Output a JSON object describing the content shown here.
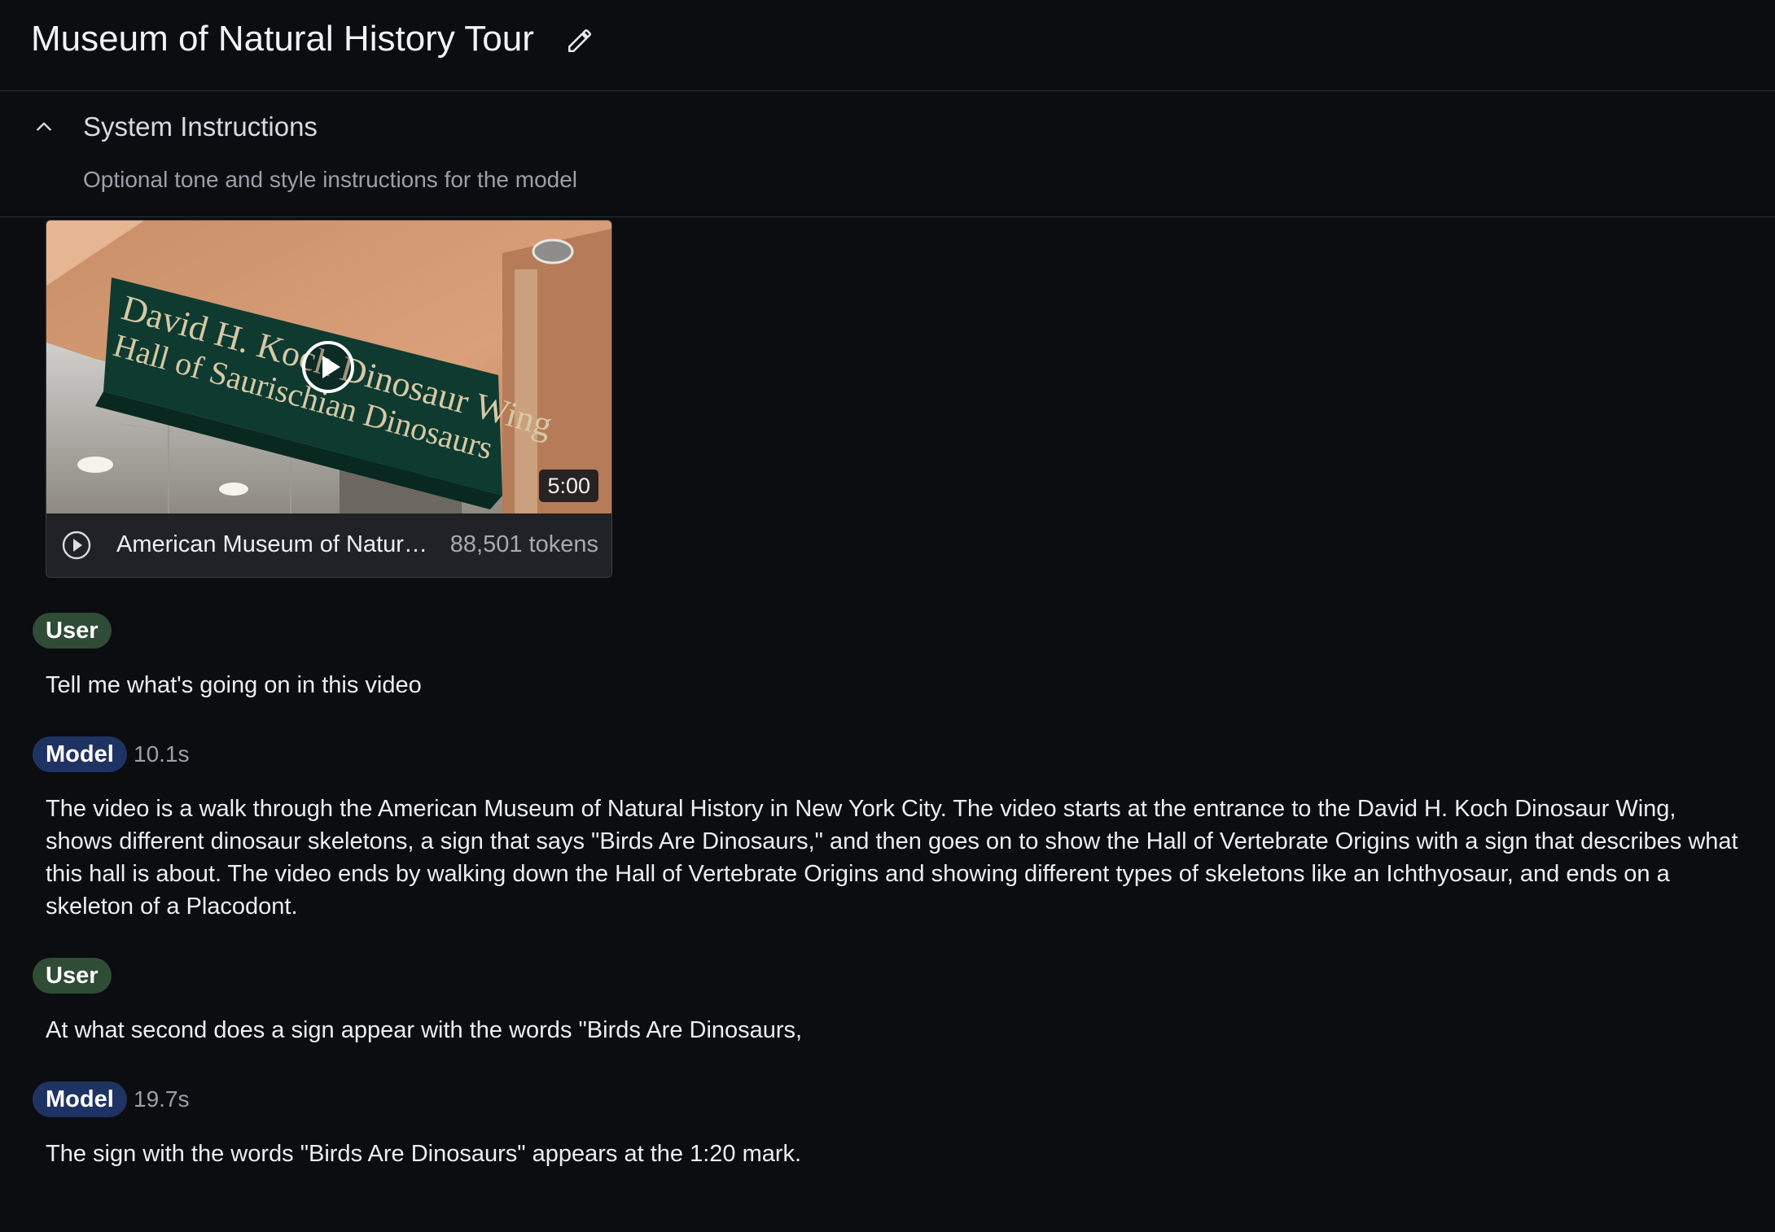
{
  "header": {
    "title": "Museum of Natural History Tour",
    "edit_icon": "pencil-icon"
  },
  "system_instructions": {
    "label": "System Instructions",
    "placeholder": "Optional tone and style instructions for the model",
    "toggle_icon": "chevron-up-icon"
  },
  "video": {
    "name": "American Museum of Natural ...",
    "tokens": "88,501 tokens",
    "duration": "5:00",
    "sign_line1": "David H. Koch Dinosaur Wing",
    "sign_line2": "Hall of Saurischian Dinosaurs",
    "play_icon": "play-circle-icon"
  },
  "messages": [
    {
      "role": "User",
      "text": "Tell me what's going on in this video"
    },
    {
      "role": "Model",
      "elapsed": "10.1s",
      "text": "The video is a walk through the American Museum of Natural History in New York City. The video starts at the entrance to the David H. Koch Dinosaur Wing, shows different dinosaur skeletons, a sign that says \"Birds Are Dinosaurs,\" and then goes on to show the Hall of Vertebrate Origins with a sign that describes what this hall is about. The video ends by walking down the Hall of Vertebrate Origins and showing different types of skeletons like an Ichthyosaur, and ends on a skeleton of a Placodont."
    },
    {
      "role": "User",
      "text": "At what second does a sign appear with the words \"Birds Are Dinosaurs,"
    },
    {
      "role": "Model",
      "elapsed": "19.7s",
      "text": "The sign with the words \"Birds Are Dinosaurs\" appears at the 1:20 mark."
    }
  ],
  "colors": {
    "background": "#0b0d11",
    "user_badge": "#2e4c36",
    "model_badge": "#1f3363",
    "sign_green": "#0f3a30"
  }
}
